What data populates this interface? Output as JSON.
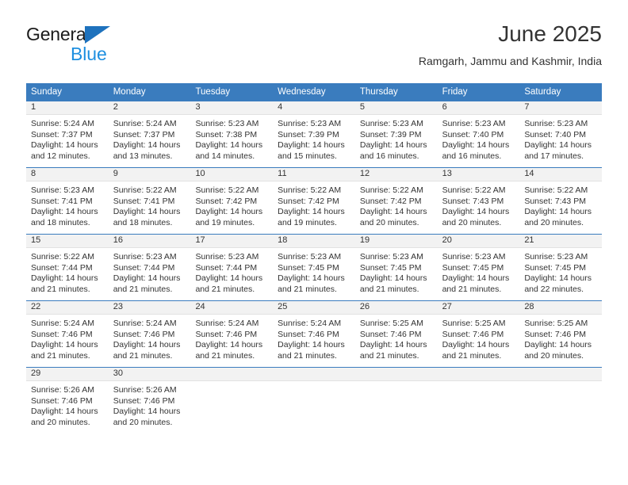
{
  "brand": {
    "word_one": "General",
    "word_two": "Blue",
    "triangle_color": "#1e72bd",
    "blue_color": "#1e8fe0"
  },
  "header": {
    "title": "June 2025",
    "subtitle": "Ramgarh, Jammu and Kashmir, India"
  },
  "theme": {
    "header_bg": "#3a7cbe",
    "daynum_bg": "#f2f2f2",
    "text": "#333333"
  },
  "weekday_headers": [
    "Sunday",
    "Monday",
    "Tuesday",
    "Wednesday",
    "Thursday",
    "Friday",
    "Saturday"
  ],
  "weeks": [
    [
      {
        "day": "1",
        "sunrise": "Sunrise: 5:24 AM",
        "sunset": "Sunset: 7:37 PM",
        "daylight_1": "Daylight: 14 hours",
        "daylight_2": "and 12 minutes."
      },
      {
        "day": "2",
        "sunrise": "Sunrise: 5:24 AM",
        "sunset": "Sunset: 7:37 PM",
        "daylight_1": "Daylight: 14 hours",
        "daylight_2": "and 13 minutes."
      },
      {
        "day": "3",
        "sunrise": "Sunrise: 5:23 AM",
        "sunset": "Sunset: 7:38 PM",
        "daylight_1": "Daylight: 14 hours",
        "daylight_2": "and 14 minutes."
      },
      {
        "day": "4",
        "sunrise": "Sunrise: 5:23 AM",
        "sunset": "Sunset: 7:39 PM",
        "daylight_1": "Daylight: 14 hours",
        "daylight_2": "and 15 minutes."
      },
      {
        "day": "5",
        "sunrise": "Sunrise: 5:23 AM",
        "sunset": "Sunset: 7:39 PM",
        "daylight_1": "Daylight: 14 hours",
        "daylight_2": "and 16 minutes."
      },
      {
        "day": "6",
        "sunrise": "Sunrise: 5:23 AM",
        "sunset": "Sunset: 7:40 PM",
        "daylight_1": "Daylight: 14 hours",
        "daylight_2": "and 16 minutes."
      },
      {
        "day": "7",
        "sunrise": "Sunrise: 5:23 AM",
        "sunset": "Sunset: 7:40 PM",
        "daylight_1": "Daylight: 14 hours",
        "daylight_2": "and 17 minutes."
      }
    ],
    [
      {
        "day": "8",
        "sunrise": "Sunrise: 5:23 AM",
        "sunset": "Sunset: 7:41 PM",
        "daylight_1": "Daylight: 14 hours",
        "daylight_2": "and 18 minutes."
      },
      {
        "day": "9",
        "sunrise": "Sunrise: 5:22 AM",
        "sunset": "Sunset: 7:41 PM",
        "daylight_1": "Daylight: 14 hours",
        "daylight_2": "and 18 minutes."
      },
      {
        "day": "10",
        "sunrise": "Sunrise: 5:22 AM",
        "sunset": "Sunset: 7:42 PM",
        "daylight_1": "Daylight: 14 hours",
        "daylight_2": "and 19 minutes."
      },
      {
        "day": "11",
        "sunrise": "Sunrise: 5:22 AM",
        "sunset": "Sunset: 7:42 PM",
        "daylight_1": "Daylight: 14 hours",
        "daylight_2": "and 19 minutes."
      },
      {
        "day": "12",
        "sunrise": "Sunrise: 5:22 AM",
        "sunset": "Sunset: 7:42 PM",
        "daylight_1": "Daylight: 14 hours",
        "daylight_2": "and 20 minutes."
      },
      {
        "day": "13",
        "sunrise": "Sunrise: 5:22 AM",
        "sunset": "Sunset: 7:43 PM",
        "daylight_1": "Daylight: 14 hours",
        "daylight_2": "and 20 minutes."
      },
      {
        "day": "14",
        "sunrise": "Sunrise: 5:22 AM",
        "sunset": "Sunset: 7:43 PM",
        "daylight_1": "Daylight: 14 hours",
        "daylight_2": "and 20 minutes."
      }
    ],
    [
      {
        "day": "15",
        "sunrise": "Sunrise: 5:22 AM",
        "sunset": "Sunset: 7:44 PM",
        "daylight_1": "Daylight: 14 hours",
        "daylight_2": "and 21 minutes."
      },
      {
        "day": "16",
        "sunrise": "Sunrise: 5:23 AM",
        "sunset": "Sunset: 7:44 PM",
        "daylight_1": "Daylight: 14 hours",
        "daylight_2": "and 21 minutes."
      },
      {
        "day": "17",
        "sunrise": "Sunrise: 5:23 AM",
        "sunset": "Sunset: 7:44 PM",
        "daylight_1": "Daylight: 14 hours",
        "daylight_2": "and 21 minutes."
      },
      {
        "day": "18",
        "sunrise": "Sunrise: 5:23 AM",
        "sunset": "Sunset: 7:45 PM",
        "daylight_1": "Daylight: 14 hours",
        "daylight_2": "and 21 minutes."
      },
      {
        "day": "19",
        "sunrise": "Sunrise: 5:23 AM",
        "sunset": "Sunset: 7:45 PM",
        "daylight_1": "Daylight: 14 hours",
        "daylight_2": "and 21 minutes."
      },
      {
        "day": "20",
        "sunrise": "Sunrise: 5:23 AM",
        "sunset": "Sunset: 7:45 PM",
        "daylight_1": "Daylight: 14 hours",
        "daylight_2": "and 21 minutes."
      },
      {
        "day": "21",
        "sunrise": "Sunrise: 5:23 AM",
        "sunset": "Sunset: 7:45 PM",
        "daylight_1": "Daylight: 14 hours",
        "daylight_2": "and 22 minutes."
      }
    ],
    [
      {
        "day": "22",
        "sunrise": "Sunrise: 5:24 AM",
        "sunset": "Sunset: 7:46 PM",
        "daylight_1": "Daylight: 14 hours",
        "daylight_2": "and 21 minutes."
      },
      {
        "day": "23",
        "sunrise": "Sunrise: 5:24 AM",
        "sunset": "Sunset: 7:46 PM",
        "daylight_1": "Daylight: 14 hours",
        "daylight_2": "and 21 minutes."
      },
      {
        "day": "24",
        "sunrise": "Sunrise: 5:24 AM",
        "sunset": "Sunset: 7:46 PM",
        "daylight_1": "Daylight: 14 hours",
        "daylight_2": "and 21 minutes."
      },
      {
        "day": "25",
        "sunrise": "Sunrise: 5:24 AM",
        "sunset": "Sunset: 7:46 PM",
        "daylight_1": "Daylight: 14 hours",
        "daylight_2": "and 21 minutes."
      },
      {
        "day": "26",
        "sunrise": "Sunrise: 5:25 AM",
        "sunset": "Sunset: 7:46 PM",
        "daylight_1": "Daylight: 14 hours",
        "daylight_2": "and 21 minutes."
      },
      {
        "day": "27",
        "sunrise": "Sunrise: 5:25 AM",
        "sunset": "Sunset: 7:46 PM",
        "daylight_1": "Daylight: 14 hours",
        "daylight_2": "and 21 minutes."
      },
      {
        "day": "28",
        "sunrise": "Sunrise: 5:25 AM",
        "sunset": "Sunset: 7:46 PM",
        "daylight_1": "Daylight: 14 hours",
        "daylight_2": "and 20 minutes."
      }
    ],
    [
      {
        "day": "29",
        "sunrise": "Sunrise: 5:26 AM",
        "sunset": "Sunset: 7:46 PM",
        "daylight_1": "Daylight: 14 hours",
        "daylight_2": "and 20 minutes."
      },
      {
        "day": "30",
        "sunrise": "Sunrise: 5:26 AM",
        "sunset": "Sunset: 7:46 PM",
        "daylight_1": "Daylight: 14 hours",
        "daylight_2": "and 20 minutes."
      },
      {
        "day": "",
        "sunrise": "",
        "sunset": "",
        "daylight_1": "",
        "daylight_2": ""
      },
      {
        "day": "",
        "sunrise": "",
        "sunset": "",
        "daylight_1": "",
        "daylight_2": ""
      },
      {
        "day": "",
        "sunrise": "",
        "sunset": "",
        "daylight_1": "",
        "daylight_2": ""
      },
      {
        "day": "",
        "sunrise": "",
        "sunset": "",
        "daylight_1": "",
        "daylight_2": ""
      },
      {
        "day": "",
        "sunrise": "",
        "sunset": "",
        "daylight_1": "",
        "daylight_2": ""
      }
    ]
  ]
}
